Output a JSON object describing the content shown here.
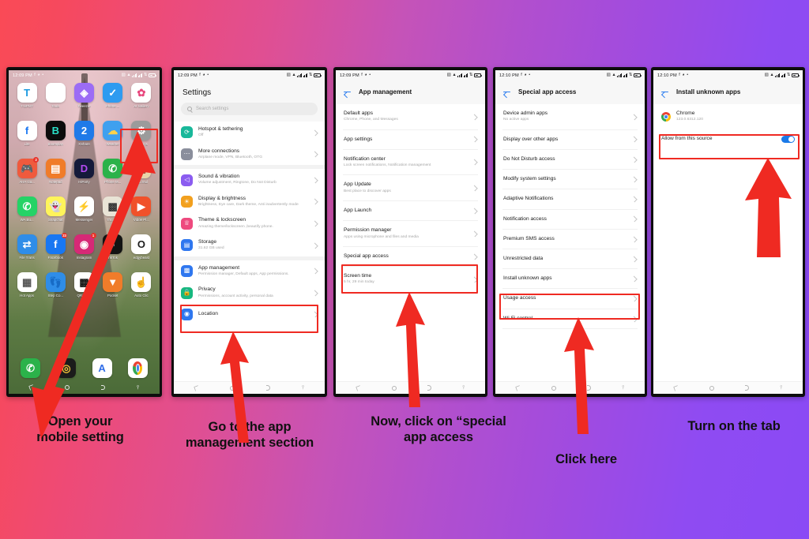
{
  "background": {
    "from": "#fa4a56",
    "to": "#8a4af5"
  },
  "accent_red": "#ef2a22",
  "phones": [
    {
      "id": "home-screen",
      "status": {
        "time": "12:09 PM",
        "icons": [
          "facebook-icon",
          "snapchat-icon",
          "dot-icon"
        ],
        "right_icons": [
          "screenshot-icon",
          "wifi-icon",
          "signal-1-icon",
          "signal-2-icon",
          "sync-icon",
          "battery-icon"
        ]
      },
      "apps": [
        {
          "label": "T-SPOT",
          "glyph": "T",
          "bg": "#ffffff",
          "fg": "#1b9ae0",
          "badge": ""
        },
        {
          "label": "Tools",
          "glyph": "folder",
          "bg": "#ffffff",
          "fg": "#444444",
          "badge": ""
        },
        {
          "label": "Tweezer",
          "glyph": "◈",
          "bg": "#9c6cf5",
          "fg": "#ffffff",
          "badge": ""
        },
        {
          "label": "Phone ...",
          "glyph": "✓",
          "bg": "#2e9bf0",
          "fg": "#ffffff",
          "badge": ""
        },
        {
          "label": "AI Gallery",
          "glyph": "✿",
          "bg": "#ffffff",
          "fg": "#e8477d",
          "badge": ""
        },
        {
          "label": "Lite",
          "glyph": "f",
          "bg": "#ffffff",
          "fg": "#1877f2",
          "badge": ""
        },
        {
          "label": "Boomplay",
          "glyph": "B",
          "bg": "#0c0c0c",
          "fg": "#2ae0c8",
          "badge": ""
        },
        {
          "label": "XShare",
          "glyph": "2",
          "bg": "#1f7ae8",
          "fg": "#ffffff",
          "badge": ""
        },
        {
          "label": "Weather",
          "glyph": "☁",
          "bg": "#3fa0ef",
          "fg": "#ffd24a",
          "badge": ""
        },
        {
          "label": "Settings",
          "glyph": "⚙",
          "bg": "#9b9b9b",
          "fg": "#ffffff",
          "badge": ""
        },
        {
          "label": "AHA Ga...",
          "glyph": "🎮",
          "bg": "#ef5a3d",
          "fg": "#ffffff",
          "badge": "2"
        },
        {
          "label": "Notepad",
          "glyph": "▤",
          "bg": "#f07c2a",
          "fg": "#ffffff",
          "badge": ""
        },
        {
          "label": "HiParty",
          "glyph": "D",
          "bg": "#141a3a",
          "fg": "#b24af0",
          "badge": ""
        },
        {
          "label": "Phone M...",
          "glyph": "✆",
          "bg": "#2bb24a",
          "fg": "#ffffff",
          "badge": ""
        },
        {
          "label": "Fo...rnul",
          "glyph": "▦",
          "bg": "#e8d4a8",
          "fg": "#b03020",
          "badge": ""
        },
        {
          "label": "WA Bu...",
          "glyph": "✆",
          "bg": "#25d366",
          "fg": "#ffffff",
          "badge": ""
        },
        {
          "label": "Snapchat",
          "glyph": "👻",
          "bg": "#fff45a",
          "fg": "#ffffff",
          "badge": ""
        },
        {
          "label": "Messenger",
          "glyph": "⚡",
          "bg": "#ffffff",
          "fg": "#a033f0",
          "badge": ""
        },
        {
          "label": "Thr...ow",
          "glyph": "▩",
          "bg": "#e9e4d6",
          "fg": "#333333",
          "badge": ""
        },
        {
          "label": "Vidoe Pl...",
          "glyph": "▶",
          "bg": "#f0512a",
          "fg": "#ffffff",
          "badge": ""
        },
        {
          "label": "File Trans",
          "glyph": "⇄",
          "bg": "#2f8de8",
          "fg": "#ffffff",
          "badge": ""
        },
        {
          "label": "Facebook",
          "glyph": "f",
          "bg": "#1877f2",
          "fg": "#ffffff",
          "badge": "23"
        },
        {
          "label": "Instagram",
          "glyph": "◉",
          "bg": "#d62976",
          "fg": "#ffffff",
          "badge": "1"
        },
        {
          "label": "TikTok",
          "glyph": "♪",
          "bg": "#131313",
          "fg": "#ffffff",
          "badge": ""
        },
        {
          "label": "edgybeast",
          "glyph": "O",
          "bg": "#ffffff",
          "fg": "#1d1d1d",
          "badge": ""
        },
        {
          "label": "Hot Apps",
          "glyph": "▦",
          "bg": "#ffffff",
          "fg": "#555555",
          "badge": ""
        },
        {
          "label": "Step Co...",
          "glyph": "👣",
          "bg": "#2f8de8",
          "fg": "#ffffff",
          "badge": ""
        },
        {
          "label": "QR/Bar...",
          "glyph": "▩",
          "bg": "#ffffff",
          "fg": "#111111",
          "badge": ""
        },
        {
          "label": "Pocket",
          "glyph": "▼",
          "bg": "#f07c2a",
          "fg": "#ffffff",
          "badge": ""
        },
        {
          "label": "Auto Clic",
          "glyph": "☝",
          "bg": "#ffffff",
          "fg": "#3a9ae0",
          "badge": ""
        }
      ],
      "dock": [
        {
          "label": "Phone",
          "glyph": "✆",
          "bg": "#2bb24a",
          "fg": "#ffffff"
        },
        {
          "label": "Camera",
          "glyph": "◎",
          "bg": "#1b1b1b",
          "fg": "#f2c43a"
        },
        {
          "label": "AZ",
          "glyph": "A",
          "bg": "#ffffff",
          "fg": "#2f6de8"
        },
        {
          "label": "Chrome",
          "glyph": "chrome",
          "bg": "#ffffff",
          "fg": "#4285f4"
        }
      ],
      "highlight": "settings-app-icon"
    },
    {
      "id": "settings-screen",
      "status": {
        "time": "12:09 PM"
      },
      "title": "Settings",
      "search_placeholder": "Search settings",
      "items": [
        {
          "title": "Hotspot & tethering",
          "sub": "Off",
          "icon_bg": "#19b89a",
          "glyph": "⟳",
          "group": 0
        },
        {
          "title": "More connections",
          "sub": "Airplane mode, VPN, Bluetooth, OTG",
          "icon_bg": "#8a8e9c",
          "glyph": "⋯",
          "group": 0
        },
        {
          "title": "Sound & vibration",
          "sub": "Volume adjustment, Ringtone, Do Not Disturb",
          "icon_bg": "#8b5cf0",
          "glyph": "◁",
          "group": 1
        },
        {
          "title": "Display & brightness",
          "sub": "Brightness, Eye care, Dark theme, Anti inadvertently mode",
          "icon_bg": "#f2a01e",
          "glyph": "☀",
          "group": 1
        },
        {
          "title": "Theme & lockscreen",
          "sub": "Amazing theme/lockscreen ,beautify phone.",
          "icon_bg": "#ee4a7e",
          "glyph": "♕",
          "group": 1
        },
        {
          "title": "Storage",
          "sub": "31.62 GB used",
          "icon_bg": "#2f77ef",
          "glyph": "▤",
          "group": 1
        },
        {
          "title": "App management",
          "sub": "Permission manager, Default apps, App permissions.",
          "icon_bg": "#2f77ef",
          "glyph": "▩",
          "group": 2,
          "highlighted": true
        },
        {
          "title": "Privacy",
          "sub": "Permissions, account activity, personal data",
          "icon_bg": "#17b87f",
          "glyph": "🔒",
          "group": 2
        },
        {
          "title": "Location",
          "sub": "",
          "icon_bg": "#2f77ef",
          "glyph": "◉",
          "group": 2
        }
      ]
    },
    {
      "id": "app-management-screen",
      "status": {
        "time": "12:09 PM"
      },
      "title": "App management",
      "items": [
        {
          "title": "Default apps",
          "sub": "Chrome, Phone, and Messages"
        },
        {
          "title": "App settings",
          "sub": ""
        },
        {
          "title": "Notification center",
          "sub": "Lock screen notifications,  Notification management"
        },
        {
          "title": "App Update",
          "sub": "Best place to discover apps"
        },
        {
          "title": "App Launch",
          "sub": ""
        },
        {
          "title": "Permission manager",
          "sub": "Apps using microphone and files and media"
        },
        {
          "title": "Special app access",
          "sub": "",
          "highlighted": true
        },
        {
          "title": "Screen time",
          "sub": "5 hr, 29 min today"
        }
      ]
    },
    {
      "id": "special-app-access-screen",
      "status": {
        "time": "12:10 PM"
      },
      "title": "Special app access",
      "items": [
        {
          "title": "Device admin apps",
          "sub": "No active apps"
        },
        {
          "title": "Display over other apps",
          "sub": ""
        },
        {
          "title": "Do Not Disturb access",
          "sub": ""
        },
        {
          "title": "Modify system settings",
          "sub": ""
        },
        {
          "title": "Adaptive Notifications",
          "sub": ""
        },
        {
          "title": "Notification access",
          "sub": ""
        },
        {
          "title": "Premium SMS access",
          "sub": ""
        },
        {
          "title": "Unrestricted data",
          "sub": ""
        },
        {
          "title": "Install unknown apps",
          "sub": "",
          "highlighted": true
        },
        {
          "title": "Usage access",
          "sub": ""
        },
        {
          "title": "Wi-Fi control",
          "sub": ""
        }
      ]
    },
    {
      "id": "install-unknown-apps-screen",
      "status": {
        "time": "12:10 PM"
      },
      "title": "Install unknown apps",
      "app": {
        "name": "Chrome",
        "version": "123.0.6312.120",
        "icon": "chrome-icon"
      },
      "toggle": {
        "label": "Allow from this source",
        "state": "on",
        "color": "#1b7ae8"
      }
    }
  ],
  "captions": [
    {
      "id": "caption-1",
      "lines": [
        "Open your",
        "mobile setting"
      ]
    },
    {
      "id": "caption-2",
      "lines": [
        "Go to the app",
        "management section"
      ]
    },
    {
      "id": "caption-3",
      "lines": [
        "Now, click on “special",
        "app access"
      ]
    },
    {
      "id": "caption-4",
      "lines": [
        "Click here"
      ]
    },
    {
      "id": "caption-5",
      "lines": [
        "Turn on the tab"
      ]
    }
  ]
}
